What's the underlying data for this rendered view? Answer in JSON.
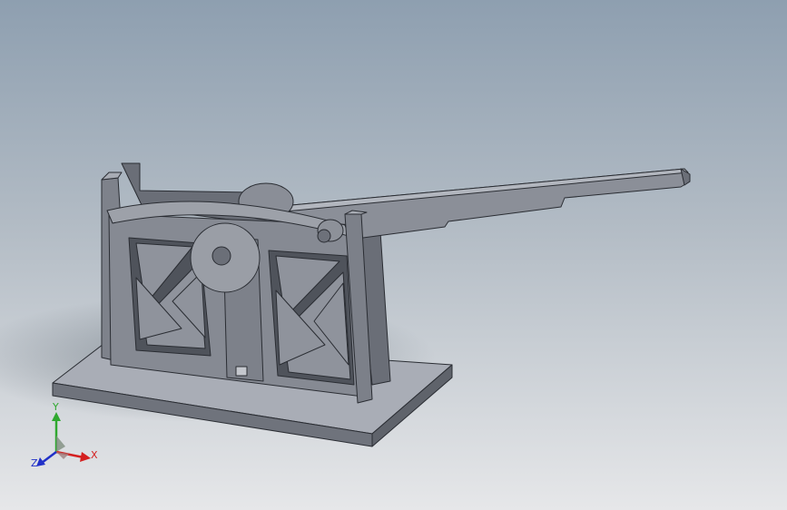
{
  "viewport": {
    "background_top": "#8fa0b0",
    "background_bottom": "#e4e6e8",
    "model_color": "#7a7e88"
  },
  "triad": {
    "x_label": "X",
    "y_label": "Y",
    "z_label": "Z",
    "x_color": "#d42020",
    "y_color": "#2fa82f",
    "z_color": "#2030c8"
  }
}
